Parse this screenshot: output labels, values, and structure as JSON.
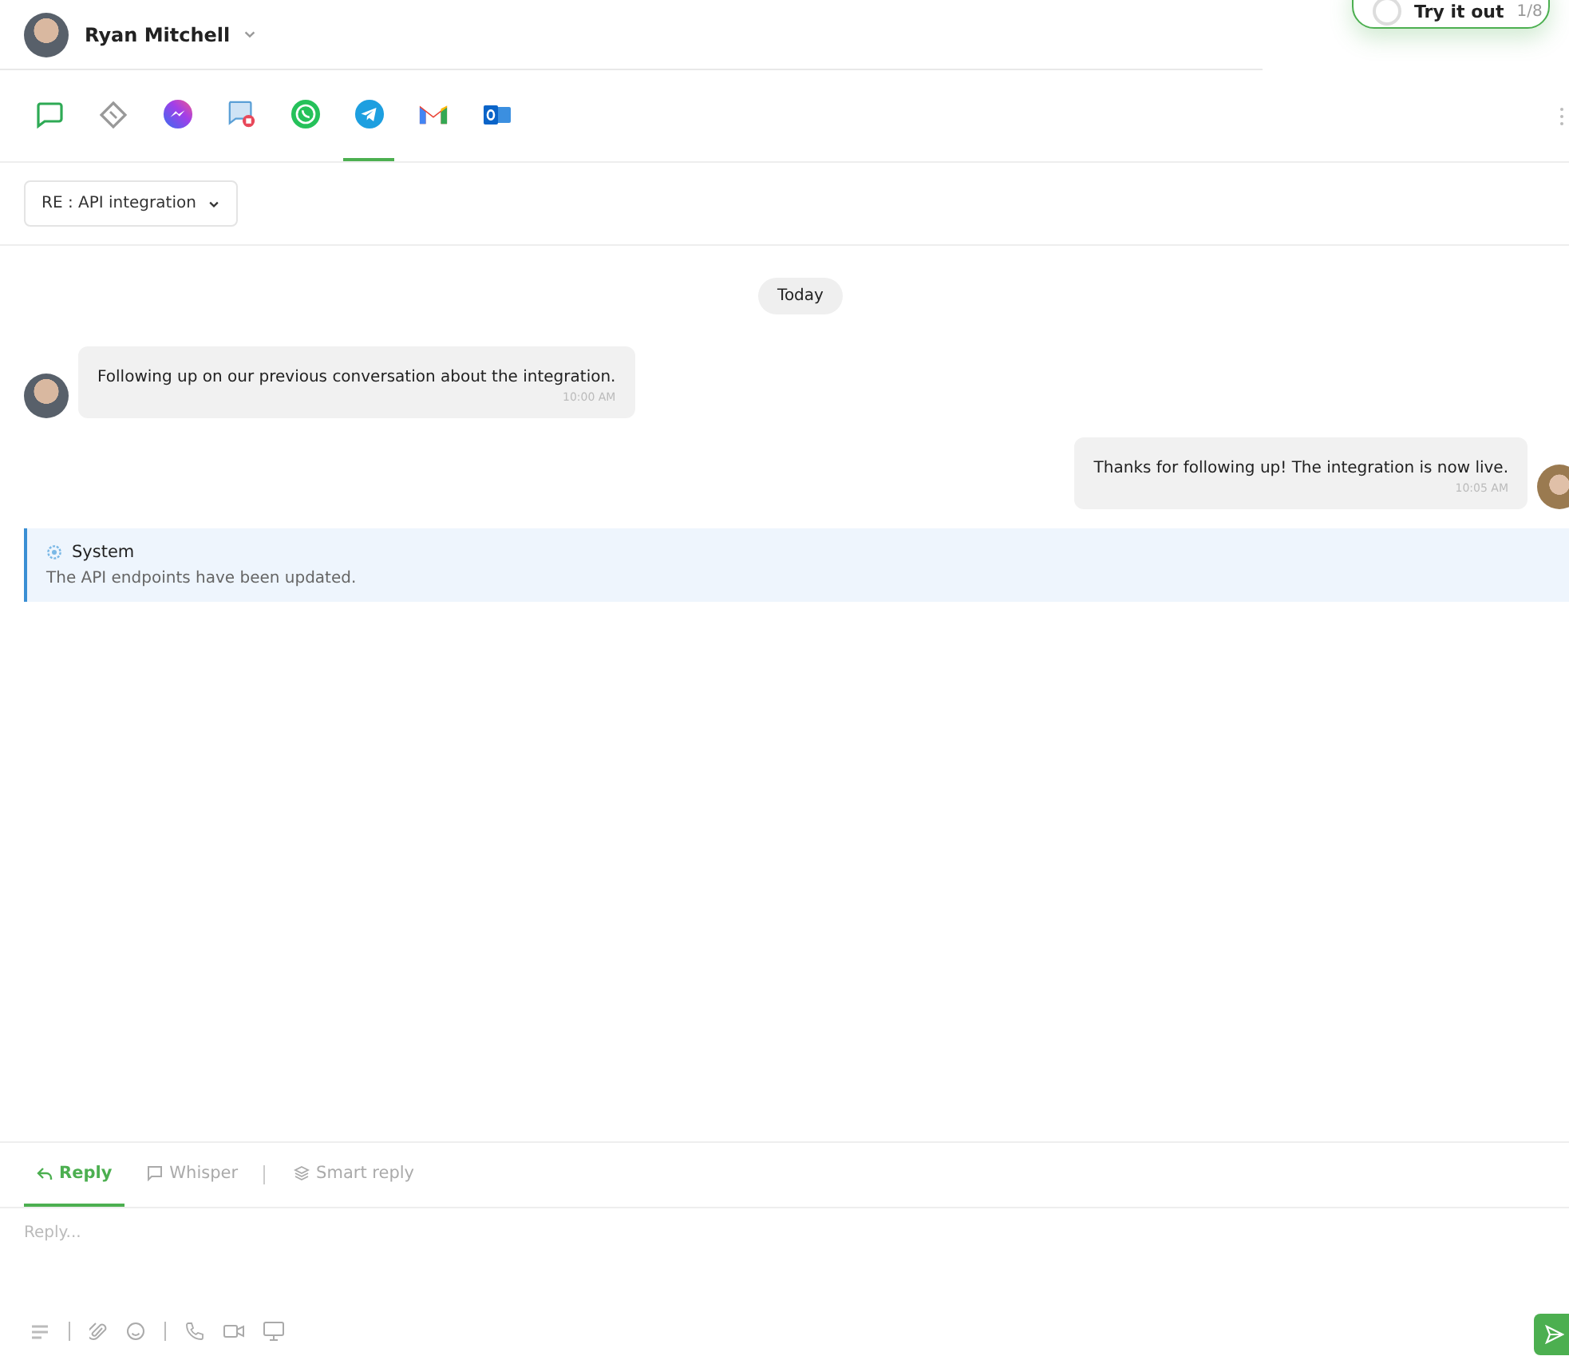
{
  "contact": {
    "name": "Ryan Mitchell"
  },
  "tour": {
    "label": "Try it out",
    "step": "1/8"
  },
  "channels": [
    {
      "kind": "chat",
      "selected": false
    },
    {
      "kind": "ticket",
      "selected": false
    },
    {
      "kind": "messenger",
      "selected": false
    },
    {
      "kind": "sms",
      "selected": false
    },
    {
      "kind": "whatsapp",
      "selected": false
    },
    {
      "kind": "telegram",
      "selected": true
    },
    {
      "kind": "gmail",
      "selected": false
    },
    {
      "kind": "outlook",
      "selected": false
    }
  ],
  "subject": "RE : API integration",
  "date_divider": "Today",
  "messages": [
    {
      "kind": "incoming",
      "text": "Following up on our previous conversation about the integration.",
      "time": "10:00 AM"
    },
    {
      "kind": "outgoing",
      "text": "Thanks for following up! The integration is now live.",
      "time": "10:05 AM"
    },
    {
      "kind": "system",
      "title": "System",
      "text": "The API endpoints have been updated."
    }
  ],
  "composer": {
    "tabs": [
      {
        "kind": "reply",
        "label": "Reply",
        "selected": true
      },
      {
        "kind": "whisper",
        "label": "Whisper",
        "selected": false
      },
      {
        "kind": "smart",
        "label": "Smart reply",
        "selected": false
      }
    ],
    "placeholder": "Reply..."
  }
}
